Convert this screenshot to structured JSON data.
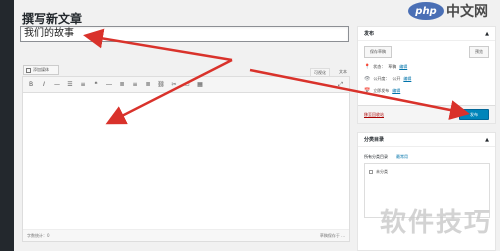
{
  "page_title": "撰写新文章",
  "title_input_value": "我们的故事",
  "add_media_label": "添加媒体",
  "editor_tabs": [
    "可视化",
    "文本"
  ],
  "status_bar": {
    "left": "字数统计：0",
    "right": "草稿保存于 ..."
  },
  "publish_box": {
    "header": "发布",
    "save_draft": "保存草稿",
    "preview": "预览",
    "status_label": "状态：",
    "status_value": "草稿",
    "status_link": "编辑",
    "visibility_label": "公开度：",
    "visibility_value": "公开",
    "visibility_link": "编辑",
    "schedule_label": "立即发布",
    "schedule_link": "编辑",
    "trash": "移至回收站",
    "publish": "发布"
  },
  "categories_box": {
    "header": "分类目录",
    "tab_all": "所有分类目录",
    "tab_popular": "最常用",
    "item": "未分类"
  },
  "watermark_logo": "php中文网",
  "watermark_bottom": "软件技巧",
  "colors": {
    "arrow": "#d9322b",
    "primary_button": "#0085ba",
    "admin_bar": "#23282d"
  }
}
